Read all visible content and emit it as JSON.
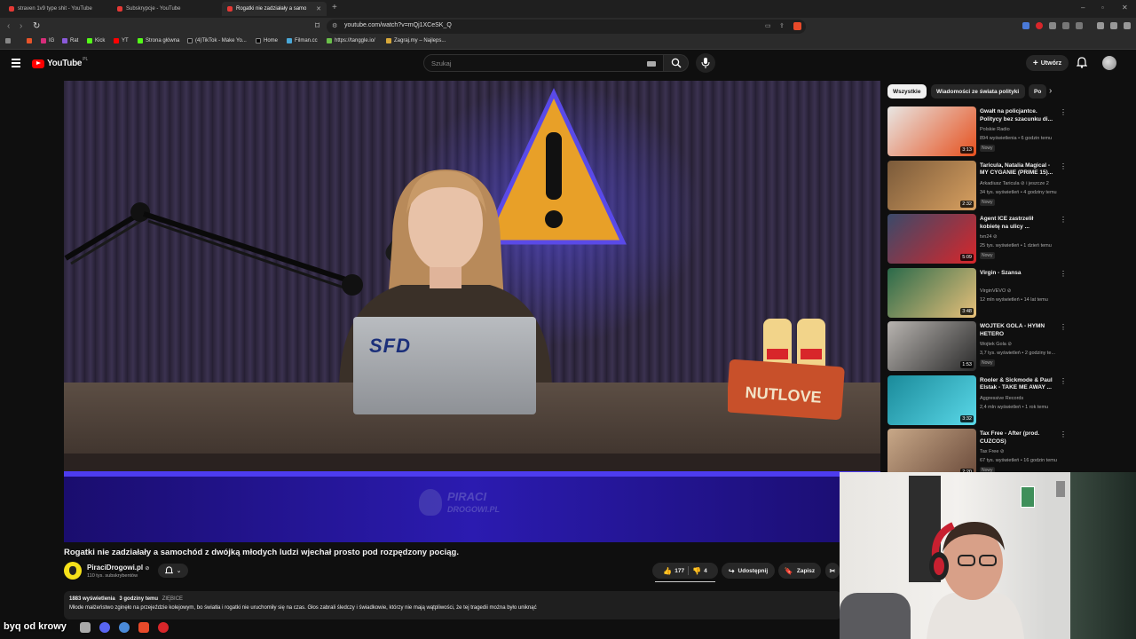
{
  "browser": {
    "tabs": [
      {
        "title": "straven 1v9 type shit - YouTube"
      },
      {
        "title": "Subskrypcje - YouTube"
      },
      {
        "title": "Rogatki nie zadziałały a samo"
      }
    ],
    "url": "youtube.com/watch?v=mQj1XCeSK_Q",
    "bookmarks": [
      "IG",
      "Rat",
      "Kick",
      "YT",
      "Strona główna",
      "(4)TikTok - Make Yo...",
      "Home",
      "Filman.cc",
      "https://tanggle.io/",
      "Zagraj.my – Najleps..."
    ]
  },
  "header": {
    "logo_text": "YouTube",
    "logo_country": "PL",
    "search_placeholder": "Szukaj",
    "create_label": "Utwórz"
  },
  "player": {
    "laptop_logo": "SFD",
    "snack_label": "NUTLOVE",
    "watermark_line1": "PIRACI",
    "watermark_line2": "DROGOWI.PL"
  },
  "video": {
    "title": "Rogatki nie zadziałały a samochód z dwójką młodych ludzi wjechał prosto pod rozpędzony pociąg.",
    "channel_name": "PiraciDrogowi.pl",
    "channel_subs": "110 tys. subskrybentów",
    "likes": "177",
    "dislikes": "4",
    "share_label": "Udostępnij",
    "save_label": "Zapisz",
    "views": "1883 wyświetlenia",
    "posted": "3 godziny temu",
    "tag": "ZIĘBICE",
    "description": "Młode małżeństwo zginęło na przejeździe kolejowym, bo światła i rogatki nie uruchomiły się na czas. Głos zabrali śledczy i świadkowie, którzy nie mają wątpliwości, że tej tragedii można było uniknąć"
  },
  "sidebar": {
    "chips": [
      "Wszystkie",
      "Wiadomości ze świata polityki",
      "Po"
    ],
    "recommendations": [
      {
        "title": "Gwałt na policjantce. Politycy bez szacunku di...",
        "channel": "Polskie Radio",
        "meta": "894 wyświetlenia • 6 godzin temu",
        "badge": "Nowy",
        "duration": "3:13",
        "thumb_color": "#e8e6e3",
        "accent": "#e6501e"
      },
      {
        "title": "Taricula, Natalia Magical - MY CYGANIE (PRIME 15)...",
        "channel": "Arkadiusz Taricula ⊘ i jeszcze 2",
        "meta": "34 tys. wyświetleń • 4 godziny temu",
        "badge": "Nowy",
        "duration": "2:32",
        "thumb_color": "#7a5a3a",
        "accent": "#d8a060"
      },
      {
        "title": "Agent ICE zastrzelił kobietę na ulicy ...",
        "channel": "tvn24 ⊘",
        "meta": "25 tys. wyświetleń • 1 dzień temu",
        "badge": "Nowy",
        "duration": "5:09",
        "thumb_color": "#3a4a6a",
        "accent": "#d8262a"
      },
      {
        "title": "Virgin - Szansa",
        "channel": "VirginVEVO ⊘",
        "meta": "12 mln wyświetleń • 14 lat temu",
        "badge": "",
        "duration": "3:48",
        "thumb_color": "#2a6a4a",
        "accent": "#e8c07a"
      },
      {
        "title": "WOJTEK GOLA - HYMN HETERO",
        "channel": "Wojtek Gola ⊘",
        "meta": "3,7 tys. wyświetleń • 2 godziny te...",
        "badge": "Nowy",
        "duration": "1:53",
        "thumb_color": "#b8b4b0",
        "accent": "#2a2a2a"
      },
      {
        "title": "Rooler & Sickmode & Paul Elstak - TAKE ME AWAY ...",
        "channel": "Aggressive Records",
        "meta": "2,4 mln wyświetleń • 1 rok temu",
        "badge": "",
        "duration": "3:32",
        "thumb_color": "#1a8a9a",
        "accent": "#5ad8e8"
      },
      {
        "title": "Tax Free - After (prod. CUZCOS)",
        "channel": "Tax Free ⊘",
        "meta": "67 tys. wyświetleń • 16 godzin temu",
        "badge": "Nowy",
        "duration": "2:20",
        "thumb_color": "#c8a888",
        "accent": "#6a4a3a"
      }
    ]
  },
  "overlay": {
    "stream_label": "byq od krowy"
  },
  "colors": {
    "accent_red": "#ff0000",
    "background": "#0f0f0f",
    "banner_blue": "#2b1bb0"
  }
}
